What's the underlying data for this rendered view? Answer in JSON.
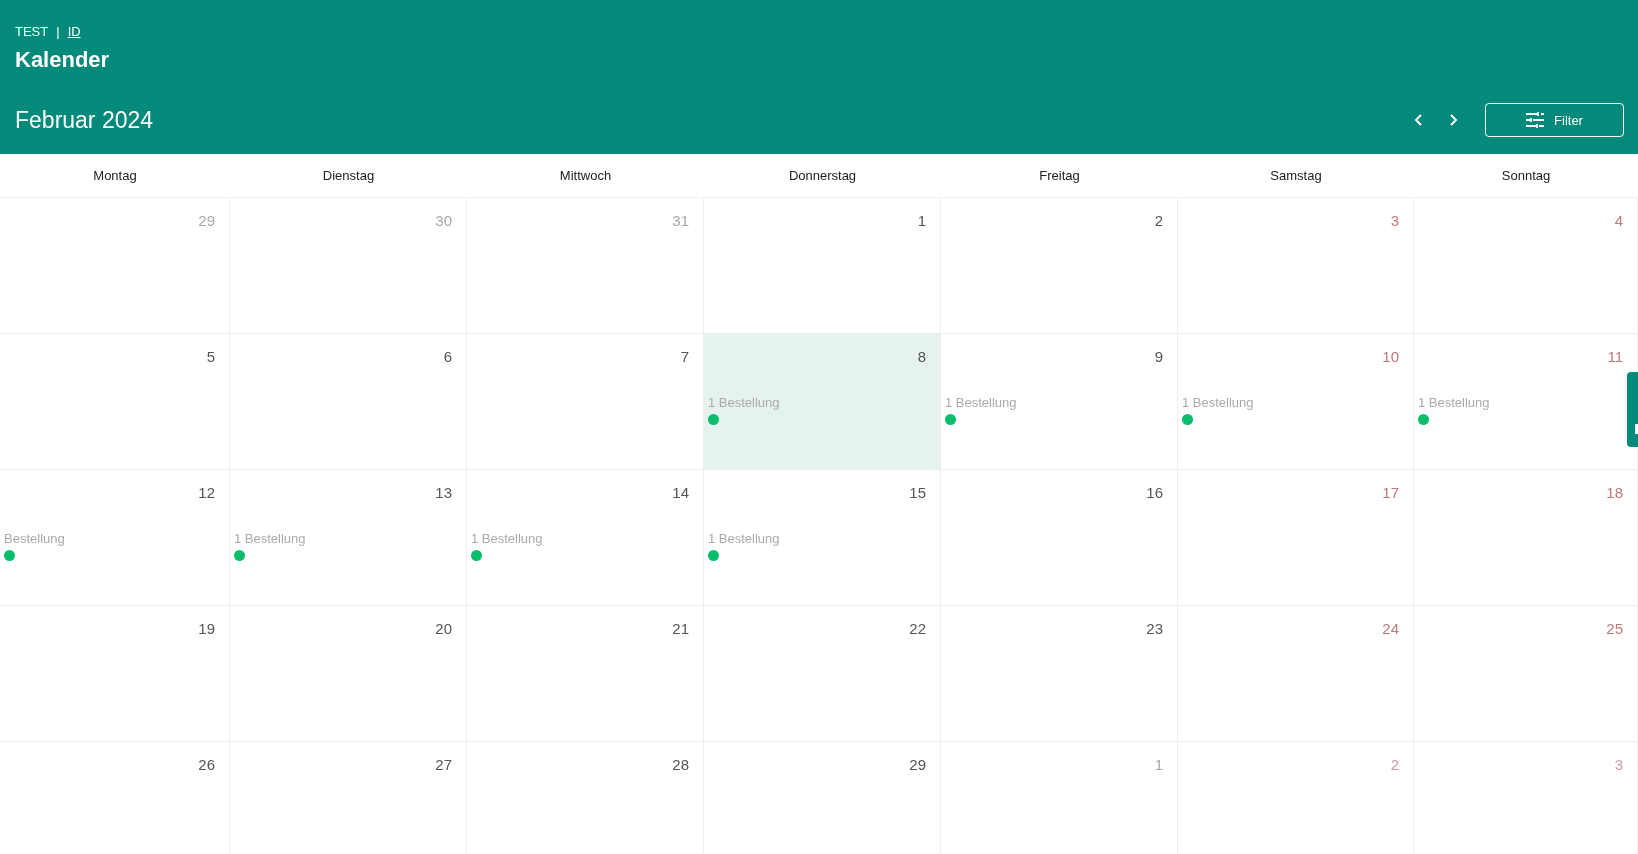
{
  "header": {
    "breadcrumb": [
      {
        "text": "TEST",
        "link": false
      },
      {
        "text": "ID",
        "link": true
      }
    ],
    "separator": "|",
    "title": "Kalender",
    "month": "Februar 2024",
    "filter_label": "Filter"
  },
  "weekdays": [
    "Montag",
    "Dienstag",
    "Mittwoch",
    "Donnerstag",
    "Freitag",
    "Samstag",
    "Sonntag"
  ],
  "weeks": [
    [
      {
        "day": "29",
        "in_month": false,
        "selected": false
      },
      {
        "day": "30",
        "in_month": false,
        "selected": false
      },
      {
        "day": "31",
        "in_month": false,
        "selected": false
      },
      {
        "day": "1",
        "in_month": true,
        "selected": false
      },
      {
        "day": "2",
        "in_month": true,
        "selected": false
      },
      {
        "day": "3",
        "in_month": true,
        "selected": false
      },
      {
        "day": "4",
        "in_month": true,
        "selected": false
      }
    ],
    [
      {
        "day": "5",
        "in_month": true,
        "selected": false
      },
      {
        "day": "6",
        "in_month": true,
        "selected": false
      },
      {
        "day": "7",
        "in_month": true,
        "selected": false
      },
      {
        "day": "8",
        "in_month": true,
        "selected": true,
        "events": [
          {
            "label": "1 Bestellung",
            "color": "#0bbf6a"
          }
        ]
      },
      {
        "day": "9",
        "in_month": true,
        "selected": false,
        "events": [
          {
            "label": "1 Bestellung",
            "color": "#0bbf6a"
          }
        ]
      },
      {
        "day": "10",
        "in_month": true,
        "selected": false,
        "events": [
          {
            "label": "1 Bestellung",
            "color": "#0bbf6a"
          }
        ]
      },
      {
        "day": "11",
        "in_month": true,
        "selected": false,
        "events": [
          {
            "label": "1 Bestellung",
            "color": "#0bbf6a"
          }
        ]
      }
    ],
    [
      {
        "day": "12",
        "in_month": true,
        "selected": false,
        "events": [
          {
            "label": "Bestellung",
            "color": "#0bbf6a"
          }
        ]
      },
      {
        "day": "13",
        "in_month": true,
        "selected": false,
        "events": [
          {
            "label": "1 Bestellung",
            "color": "#0bbf6a"
          }
        ]
      },
      {
        "day": "14",
        "in_month": true,
        "selected": false,
        "events": [
          {
            "label": "1 Bestellung",
            "color": "#0bbf6a"
          }
        ]
      },
      {
        "day": "15",
        "in_month": true,
        "selected": false,
        "events": [
          {
            "label": "1 Bestellung",
            "color": "#0bbf6a"
          }
        ]
      },
      {
        "day": "16",
        "in_month": true,
        "selected": false
      },
      {
        "day": "17",
        "in_month": true,
        "selected": false
      },
      {
        "day": "18",
        "in_month": true,
        "selected": false
      }
    ],
    [
      {
        "day": "19",
        "in_month": true,
        "selected": false
      },
      {
        "day": "20",
        "in_month": true,
        "selected": false
      },
      {
        "day": "21",
        "in_month": true,
        "selected": false
      },
      {
        "day": "22",
        "in_month": true,
        "selected": false
      },
      {
        "day": "23",
        "in_month": true,
        "selected": false
      },
      {
        "day": "24",
        "in_month": true,
        "selected": false
      },
      {
        "day": "25",
        "in_month": true,
        "selected": false
      }
    ],
    [
      {
        "day": "26",
        "in_month": true,
        "selected": false
      },
      {
        "day": "27",
        "in_month": true,
        "selected": false
      },
      {
        "day": "28",
        "in_month": true,
        "selected": false
      },
      {
        "day": "29",
        "in_month": true,
        "selected": false
      },
      {
        "day": "1",
        "in_month": false,
        "selected": false
      },
      {
        "day": "2",
        "in_month": false,
        "selected": false
      },
      {
        "day": "3",
        "in_month": false,
        "selected": false
      }
    ]
  ]
}
